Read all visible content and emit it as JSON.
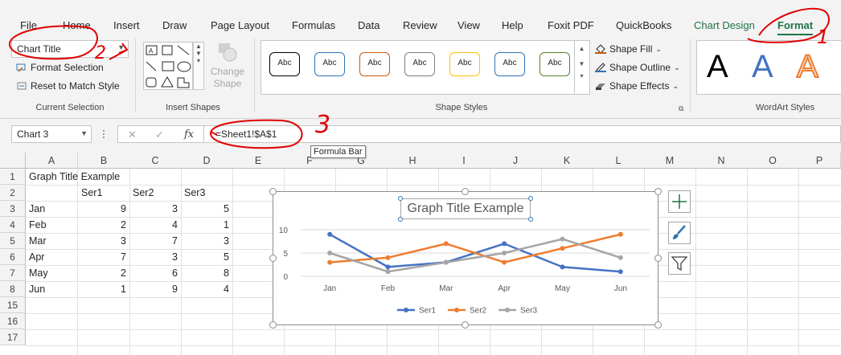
{
  "tabs": [
    "File",
    "Home",
    "Insert",
    "Draw",
    "Page Layout",
    "Formulas",
    "Data",
    "Review",
    "View",
    "Help",
    "Foxit PDF",
    "QuickBooks",
    "Chart Design",
    "Format"
  ],
  "ribbon": {
    "current_selection": {
      "dropdown_value": "Chart Title",
      "format_selection": "Format Selection",
      "reset_style": "Reset to Match Style",
      "label": "Current Selection"
    },
    "insert_shapes": {
      "change_shape": "Change",
      "change_shape_2": "Shape",
      "label": "Insert Shapes"
    },
    "shape_styles": {
      "swatch_text": "Abc",
      "swatch_colors": [
        "#000000",
        "#2f75b5",
        "#c55a11",
        "#7f7f7f",
        "#ffc000",
        "#2f75b5",
        "#548235"
      ],
      "shape_fill": "Shape Fill",
      "shape_outline": "Shape Outline",
      "shape_effects": "Shape Effects",
      "label": "Shape Styles"
    },
    "wordart": {
      "letter": "A",
      "label": "WordArt Styles"
    }
  },
  "formula_bar": {
    "name_box": "Chart 3",
    "formula": "=Sheet1!$A$1",
    "tooltip": "Formula Bar",
    "cancel_symbol": "✕",
    "enter_symbol": "✓",
    "fx_symbol": "fx"
  },
  "sheet": {
    "columns": [
      "A",
      "B",
      "C",
      "D",
      "E",
      "F",
      "G",
      "H",
      "I",
      "J",
      "K",
      "L",
      "M",
      "N",
      "O",
      "P"
    ],
    "rows": [
      "1",
      "2",
      "3",
      "4",
      "5",
      "6",
      "7",
      "8",
      "15",
      "16",
      "17"
    ],
    "cells": {
      "title": "Graph Title Example",
      "headers": [
        "Ser1",
        "Ser2",
        "Ser3"
      ],
      "data": [
        [
          "Jan",
          "9",
          "3",
          "5"
        ],
        [
          "Feb",
          "2",
          "4",
          "1"
        ],
        [
          "Mar",
          "3",
          "7",
          "3"
        ],
        [
          "Apr",
          "7",
          "3",
          "5"
        ],
        [
          "May",
          "2",
          "6",
          "8"
        ],
        [
          "Jun",
          "1",
          "9",
          "4"
        ]
      ]
    }
  },
  "chart_data": {
    "type": "line",
    "title": "Graph Title Example",
    "categories": [
      "Jan",
      "Feb",
      "Mar",
      "Apr",
      "May",
      "Jun"
    ],
    "series": [
      {
        "name": "Ser1",
        "values": [
          9,
          2,
          3,
          7,
          2,
          1
        ],
        "color": "#4472c4"
      },
      {
        "name": "Ser2",
        "values": [
          3,
          4,
          7,
          3,
          6,
          9
        ],
        "color": "#ed7d31"
      },
      {
        "name": "Ser3",
        "values": [
          5,
          1,
          3,
          5,
          8,
          4
        ],
        "color": "#a5a5a5"
      }
    ],
    "yticks": [
      "0",
      "5",
      "10"
    ],
    "ylim": [
      0,
      10
    ],
    "grid": true,
    "legend": "bottom"
  },
  "annotations": [
    "1",
    "2",
    "3"
  ],
  "colors": {
    "excel_green": "#217346",
    "annotation_red": "#e00000"
  }
}
